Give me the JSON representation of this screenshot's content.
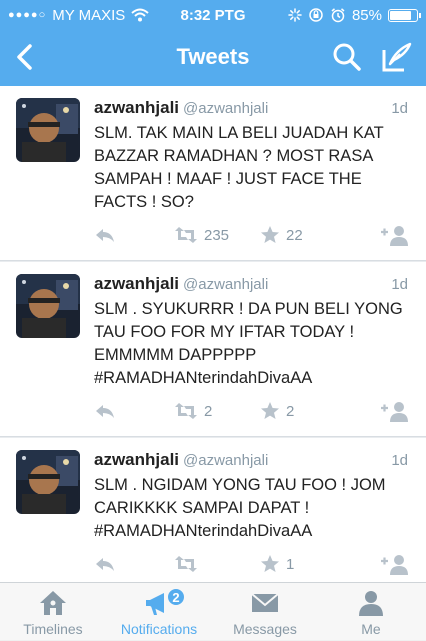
{
  "status_bar": {
    "carrier": "MY MAXIS",
    "time": "8:32 PTG",
    "battery_percent": "85%",
    "battery_level": 0.85
  },
  "nav": {
    "title": "Tweets",
    "icons": [
      "back-chevron-icon",
      "search-icon",
      "compose-icon"
    ]
  },
  "tweets": [
    {
      "name": "azwanhjali",
      "handle": "@azwanhjali",
      "time": "1d",
      "text": "SLM. TAK MAIN LA BELI JUADAH KAT BAZZAR RAMADHAN ? MOST RASA SAMPAH ! MAAF ! JUST FACE THE FACTS ! SO?",
      "retweets": "235",
      "favorites": "22"
    },
    {
      "name": "azwanhjali",
      "handle": "@azwanhjali",
      "time": "1d",
      "text": "SLM . SYUKURRR ! DA PUN BELI YONG TAU FOO FOR MY IFTAR TODAY ! EMMMMM DAPPPPP #RAMADHANterindahDivaAA",
      "retweets": "2",
      "favorites": "2"
    },
    {
      "name": "azwanhjali",
      "handle": "@azwanhjali",
      "time": "1d",
      "text": "SLM . NGIDAM YONG TAU FOO ! JOM CARIKKKK SAMPAI DAPAT ! #RAMADHANterindahDivaAA",
      "retweets": "",
      "favorites": "1"
    }
  ],
  "tabs": {
    "timelines": "Timelines",
    "notifications": "Notifications",
    "notifications_badge": "2",
    "messages": "Messages",
    "me": "Me"
  },
  "colors": {
    "accent": "#55acee",
    "muted": "#8899a6"
  }
}
